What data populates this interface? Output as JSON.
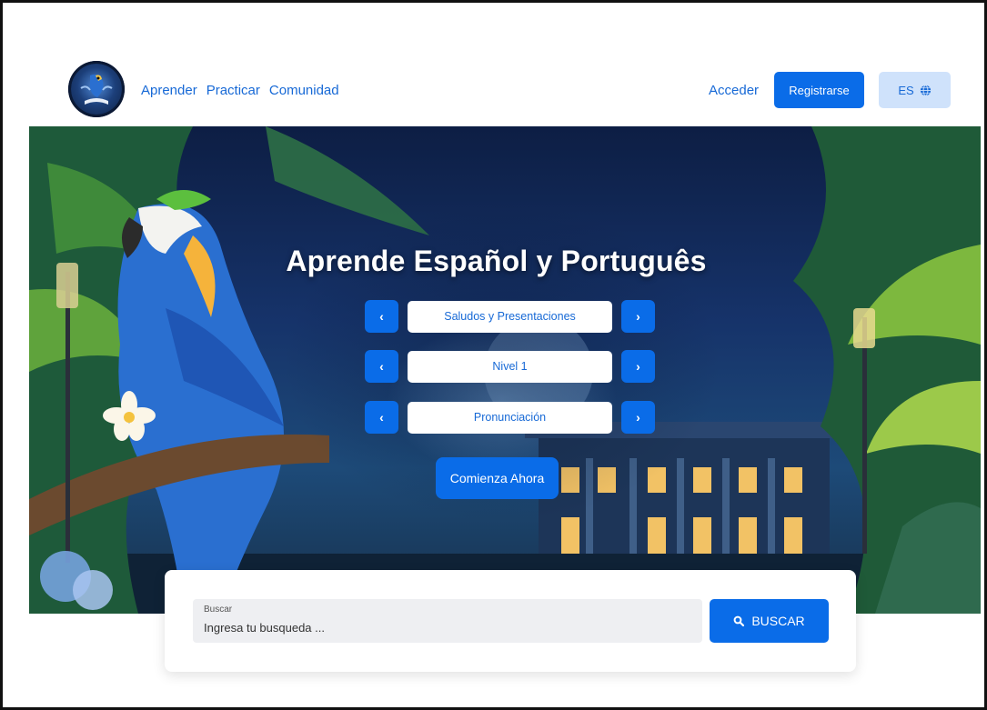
{
  "header": {
    "nav": [
      "Aprender",
      "Practicar",
      "Comunidad"
    ],
    "login_label": "Acceder",
    "register_label": "Registrarse",
    "language_label": "ES"
  },
  "hero": {
    "title": "Aprende Español y Português",
    "selectors": [
      {
        "value": "Saludos y Presentaciones"
      },
      {
        "value": "Nivel 1"
      },
      {
        "value": "Pronunciación"
      }
    ],
    "prev_icon": "chevron-left-icon",
    "next_icon": "chevron-right-icon",
    "start_label": "Comienza Ahora"
  },
  "search": {
    "label": "Buscar",
    "placeholder": "Ingresa tu busqueda ...",
    "button_label": "BUSCAR",
    "button_icon": "search-icon"
  },
  "colors": {
    "primary": "#0a6ce8",
    "link": "#1769d6",
    "lang_bg": "#cfe2fb"
  }
}
